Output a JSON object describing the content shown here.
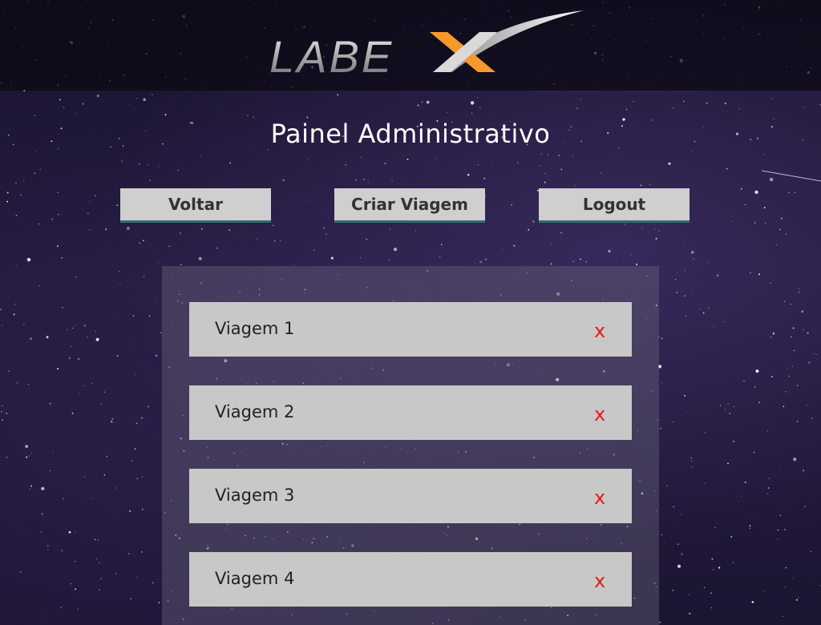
{
  "app": {
    "logo_text": "LABEX",
    "colors": {
      "accent_orange": "#f39a2b",
      "delete_red": "#e81818",
      "button_bg": "#cfcfcf",
      "button_border": "#2f6f73"
    }
  },
  "header": {
    "title": "Painel Administrativo"
  },
  "toolbar": {
    "back_label": "Voltar",
    "create_label": "Criar Viagem",
    "logout_label": "Logout"
  },
  "trips": [
    {
      "name": "Viagem 1",
      "delete_label": "x"
    },
    {
      "name": "Viagem 2",
      "delete_label": "x"
    },
    {
      "name": "Viagem 3",
      "delete_label": "x"
    },
    {
      "name": "Viagem 4",
      "delete_label": "x"
    }
  ]
}
